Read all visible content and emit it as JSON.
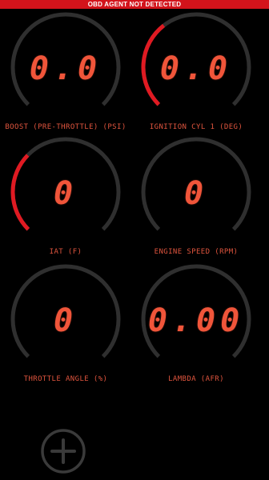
{
  "banner": {
    "text": "OBD AGENT NOT DETECTED",
    "color": "#d3131b"
  },
  "theme": {
    "track_color": "#2f2f2f",
    "active_color": "#e01a22",
    "value_color": "#f0553a",
    "label_color": "#e0553e"
  },
  "gauges": [
    {
      "value": "0.0",
      "label": "BOOST (PRE-THROTTLE) (PSI)",
      "level": 0.0
    },
    {
      "value": "0.0",
      "label": "IGNITION CYL 1 (DEG)",
      "level": 0.36
    },
    {
      "value": "0",
      "label": "IAT (F)",
      "level": 0.33
    },
    {
      "value": "0",
      "label": "ENGINE SPEED (RPM)",
      "level": 0.0
    },
    {
      "value": "0",
      "label": "THROTTLE ANGLE (%)",
      "level": 0.0
    },
    {
      "value": "0.00",
      "label": "LAMBDA (AFR)",
      "level": 0.0
    }
  ],
  "add_button": {
    "icon": "plus-circle-icon"
  }
}
